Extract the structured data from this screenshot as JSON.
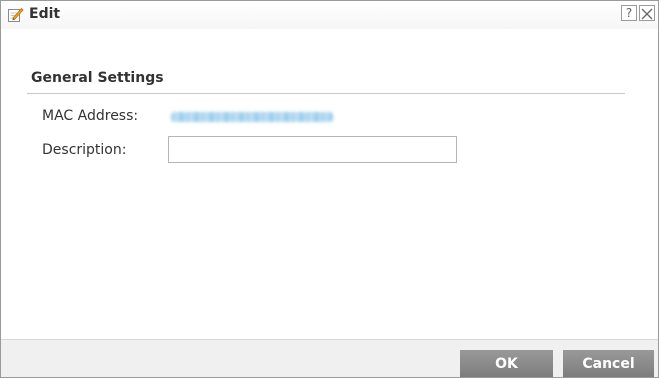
{
  "dialog": {
    "title": "Edit",
    "title_icon": "edit-pencil-icon",
    "help_label": "?",
    "help_icon": "help-icon",
    "close_icon": "close-icon"
  },
  "general_settings": {
    "heading": "General Settings",
    "mac_address": {
      "label": "MAC Address:",
      "value": "",
      "value_blurred": true
    },
    "description": {
      "label": "Description:",
      "value": ""
    }
  },
  "footer": {
    "ok_label": "OK",
    "cancel_label": "Cancel"
  },
  "colors": {
    "button_bg": "#8a8a8a",
    "button_text": "#ffffff",
    "blurred_value": "#9fd0ee",
    "footer_bg": "#f0f0f0"
  }
}
